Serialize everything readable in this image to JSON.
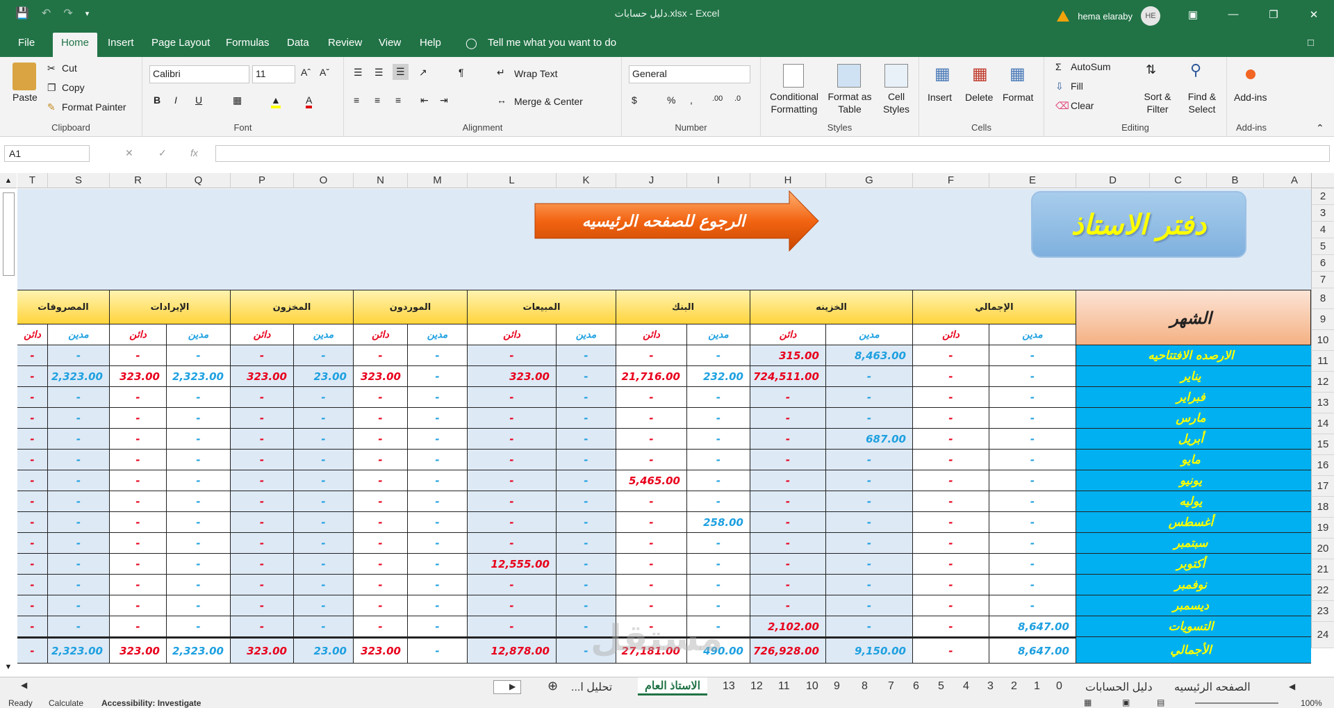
{
  "window": {
    "title": "دليل حسابات.xlsx  -  Excel",
    "user_name": "hema elaraby",
    "user_initials": "HE"
  },
  "tabs": [
    "File",
    "Home",
    "Insert",
    "Page Layout",
    "Formulas",
    "Data",
    "Review",
    "View",
    "Help"
  ],
  "tell_me": "Tell me what you want to do",
  "ribbon": {
    "clipboard": {
      "paste": "Paste",
      "cut": "Cut",
      "copy": "Copy",
      "format_painter": "Format Painter",
      "label": "Clipboard"
    },
    "font": {
      "name": "Calibri",
      "size": "11",
      "label": "Font"
    },
    "alignment": {
      "wrap_text": "Wrap Text",
      "merge_center": "Merge & Center",
      "label": "Alignment"
    },
    "number": {
      "format": "General",
      "label": "Number"
    },
    "styles": {
      "conditional": "Conditional",
      "conditional2": "Formatting",
      "format_as": "Format as",
      "format_as2": "Table",
      "cell": "Cell",
      "cell2": "Styles",
      "label": "Styles"
    },
    "cells": {
      "insert": "Insert",
      "delete": "Delete",
      "format": "Format",
      "label": "Cells"
    },
    "editing": {
      "autosum": "AutoSum",
      "fill": "Fill",
      "clear": "Clear",
      "sort": "Sort &",
      "sort2": "Filter",
      "find": "Find &",
      "find2": "Select",
      "label": "Editing"
    },
    "addins": {
      "btn": "Add-ins",
      "label": "Add-ins"
    }
  },
  "formula_bar": {
    "name_box": "A1",
    "formula": ""
  },
  "columns": [
    "T",
    "S",
    "R",
    "Q",
    "P",
    "O",
    "N",
    "M",
    "L",
    "K",
    "J",
    "I",
    "H",
    "G",
    "F",
    "E",
    "D",
    "C",
    "B",
    "A"
  ],
  "rows": [
    "2",
    "3",
    "4",
    "5",
    "6",
    "7",
    "8",
    "9",
    "10",
    "11",
    "12",
    "13",
    "14",
    "15",
    "16",
    "17",
    "18",
    "19",
    "20",
    "21",
    "22",
    "23",
    "24"
  ],
  "banner": {
    "title": "دفتر الاستاذ",
    "back_button": "الرجوع للصفحه الرئيسيه"
  },
  "table": {
    "month_header": "الشهر",
    "groups": [
      "الإجمالي",
      "الخزينه",
      "البنك",
      "المبيعات",
      "الموردون",
      "المخزون",
      "الإيرادات",
      "المصروفات"
    ],
    "debit": "مدين",
    "credit": "دائن",
    "rows": [
      {
        "label": "الارصده الافتتاحيه",
        "values": [
          "-",
          "-",
          "8,463.00",
          "315.00",
          "-",
          "-",
          "-",
          "-",
          "-",
          "-",
          "-",
          "-",
          "-",
          "-",
          "-",
          "-"
        ]
      },
      {
        "label": "يناير",
        "values": [
          "-",
          "-",
          "-",
          "724,511.00",
          "232.00",
          "21,716.00",
          "-",
          "323.00",
          "-",
          "323.00",
          "23.00",
          "323.00",
          "2,323.00",
          "323.00",
          "2,323.00",
          "-"
        ]
      },
      {
        "label": "فبراير",
        "values": [
          "-",
          "-",
          "-",
          "-",
          "-",
          "-",
          "-",
          "-",
          "-",
          "-",
          "-",
          "-",
          "-",
          "-",
          "-",
          "-"
        ]
      },
      {
        "label": "مارس",
        "values": [
          "-",
          "-",
          "-",
          "-",
          "-",
          "-",
          "-",
          "-",
          "-",
          "-",
          "-",
          "-",
          "-",
          "-",
          "-",
          "-"
        ]
      },
      {
        "label": "أبريل",
        "values": [
          "-",
          "-",
          "687.00",
          "-",
          "-",
          "-",
          "-",
          "-",
          "-",
          "-",
          "-",
          "-",
          "-",
          "-",
          "-",
          "-"
        ]
      },
      {
        "label": "مايو",
        "values": [
          "-",
          "-",
          "-",
          "-",
          "-",
          "-",
          "-",
          "-",
          "-",
          "-",
          "-",
          "-",
          "-",
          "-",
          "-",
          "-"
        ]
      },
      {
        "label": "يونيو",
        "values": [
          "-",
          "-",
          "-",
          "-",
          "-",
          "5,465.00",
          "-",
          "-",
          "-",
          "-",
          "-",
          "-",
          "-",
          "-",
          "-",
          "-"
        ]
      },
      {
        "label": "يوليه",
        "values": [
          "-",
          "-",
          "-",
          "-",
          "-",
          "-",
          "-",
          "-",
          "-",
          "-",
          "-",
          "-",
          "-",
          "-",
          "-",
          "-"
        ]
      },
      {
        "label": "أغسطس",
        "values": [
          "-",
          "-",
          "-",
          "-",
          "258.00",
          "-",
          "-",
          "-",
          "-",
          "-",
          "-",
          "-",
          "-",
          "-",
          "-",
          "-"
        ]
      },
      {
        "label": "سبتمبر",
        "values": [
          "-",
          "-",
          "-",
          "-",
          "-",
          "-",
          "-",
          "-",
          "-",
          "-",
          "-",
          "-",
          "-",
          "-",
          "-",
          "-"
        ]
      },
      {
        "label": "أكتوبر",
        "values": [
          "-",
          "-",
          "-",
          "-",
          "-",
          "-",
          "-",
          "12,555.00",
          "-",
          "-",
          "-",
          "-",
          "-",
          "-",
          "-",
          "-"
        ]
      },
      {
        "label": "نوفمبر",
        "values": [
          "-",
          "-",
          "-",
          "-",
          "-",
          "-",
          "-",
          "-",
          "-",
          "-",
          "-",
          "-",
          "-",
          "-",
          "-",
          "-"
        ]
      },
      {
        "label": "ديسمبر",
        "values": [
          "-",
          "-",
          "-",
          "-",
          "-",
          "-",
          "-",
          "-",
          "-",
          "-",
          "-",
          "-",
          "-",
          "-",
          "-",
          "-"
        ]
      },
      {
        "label": "التسويات",
        "values": [
          "8,647.00",
          "-",
          "-",
          "2,102.00",
          "-",
          "-",
          "-",
          "-",
          "-",
          "-",
          "-",
          "-",
          "-",
          "-",
          "-",
          "-"
        ]
      },
      {
        "label": "الأجمالي",
        "values": [
          "8,647.00",
          "-",
          "9,150.00",
          "726,928.00",
          "490.00",
          "27,181.00",
          "-",
          "12,878.00",
          "-",
          "323.00",
          "23.00",
          "323.00",
          "2,323.00",
          "323.00",
          "2,323.00",
          "-"
        ]
      }
    ]
  },
  "sheet_tabs": [
    "الصفحه الرئيسيه",
    "دليل الحسابات",
    "0",
    "1",
    "2",
    "3",
    "4",
    "5",
    "6",
    "7",
    "8",
    "9",
    "10",
    "11",
    "12",
    "13",
    "الاستاذ العام",
    "تحليل ا..."
  ],
  "active_sheet": "الاستاذ العام",
  "status": {
    "ready": "Ready",
    "calculate": "Calculate",
    "accessibility": "Accessibility: Investigate",
    "zoom": "100%"
  },
  "watermark": "مستقل"
}
